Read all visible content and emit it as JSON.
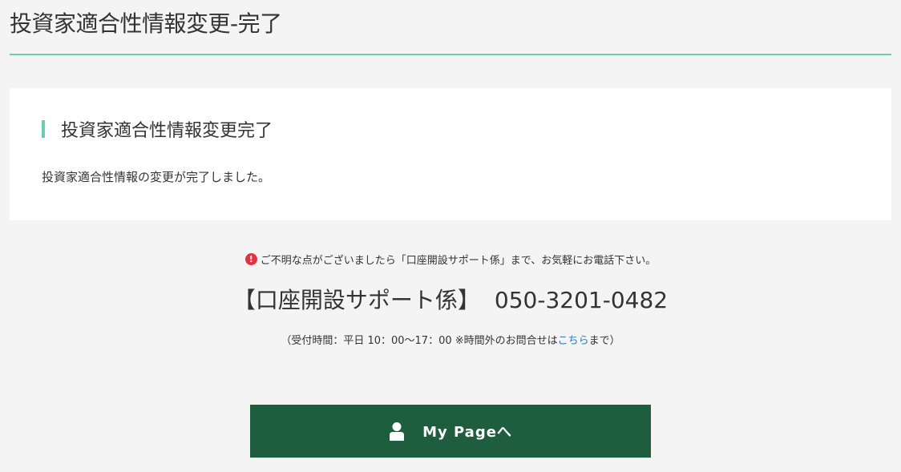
{
  "header": {
    "title": "投資家適合性情報変更-完了"
  },
  "card": {
    "heading": "投資家適合性情報変更完了",
    "message": "投資家適合性情報の変更が完了しました。"
  },
  "support": {
    "notice": "ご不明な点がございましたら「口座開設サポート係」まで、お気軽にお電話下さい。",
    "notice_icon": "exclamation-circle-icon",
    "desk_name": "【口座開設サポート係】",
    "phone_number": "050-3201-0482",
    "hours_prefix": "（受付時間：平日 10：00～17：00 ※時間外のお問合せは",
    "hours_link": "こちら",
    "hours_suffix": "まで）"
  },
  "mypage_button": {
    "label": "My Pageへ",
    "icon": "user-icon"
  },
  "colors": {
    "accent": "#6dcdb0",
    "button_bg": "#1e5e3e",
    "warning": "#e0343f",
    "link": "#2a7ac0",
    "page_bg": "#f4f4f4"
  }
}
